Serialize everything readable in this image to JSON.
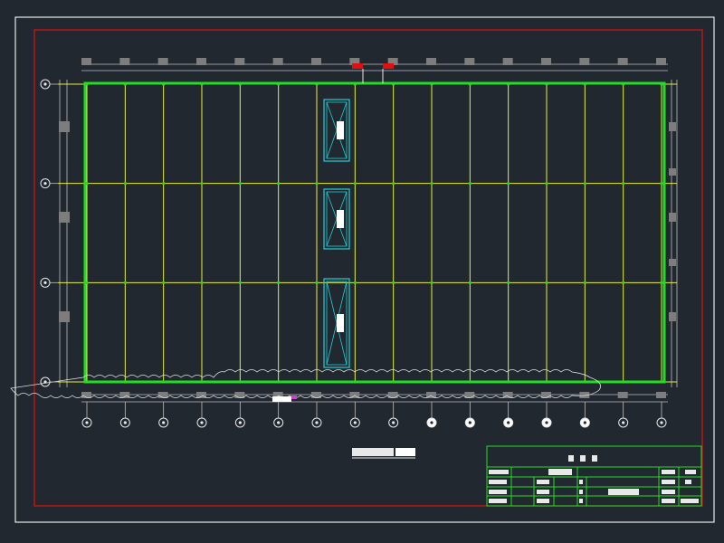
{
  "drawing": {
    "title_text": "",
    "title_block": {
      "header_text": "",
      "cells": []
    }
  },
  "colors": {
    "background": "#212830",
    "outer_frame": "#e8e8e8",
    "border_frame": "#e01010",
    "grid_lines": "#e6ef3c",
    "perimeter_beam": "#22dd22",
    "skylight": "#1fd0d8",
    "column_marks": "#7d7d7d",
    "title_block": "#22dd22",
    "dimension_lines": "#bfbfbf",
    "cloud_outline": "#e0e0e0"
  },
  "plan": {
    "column_axes_count": 16,
    "row_axes_count": 4,
    "skylights_count": 3
  }
}
